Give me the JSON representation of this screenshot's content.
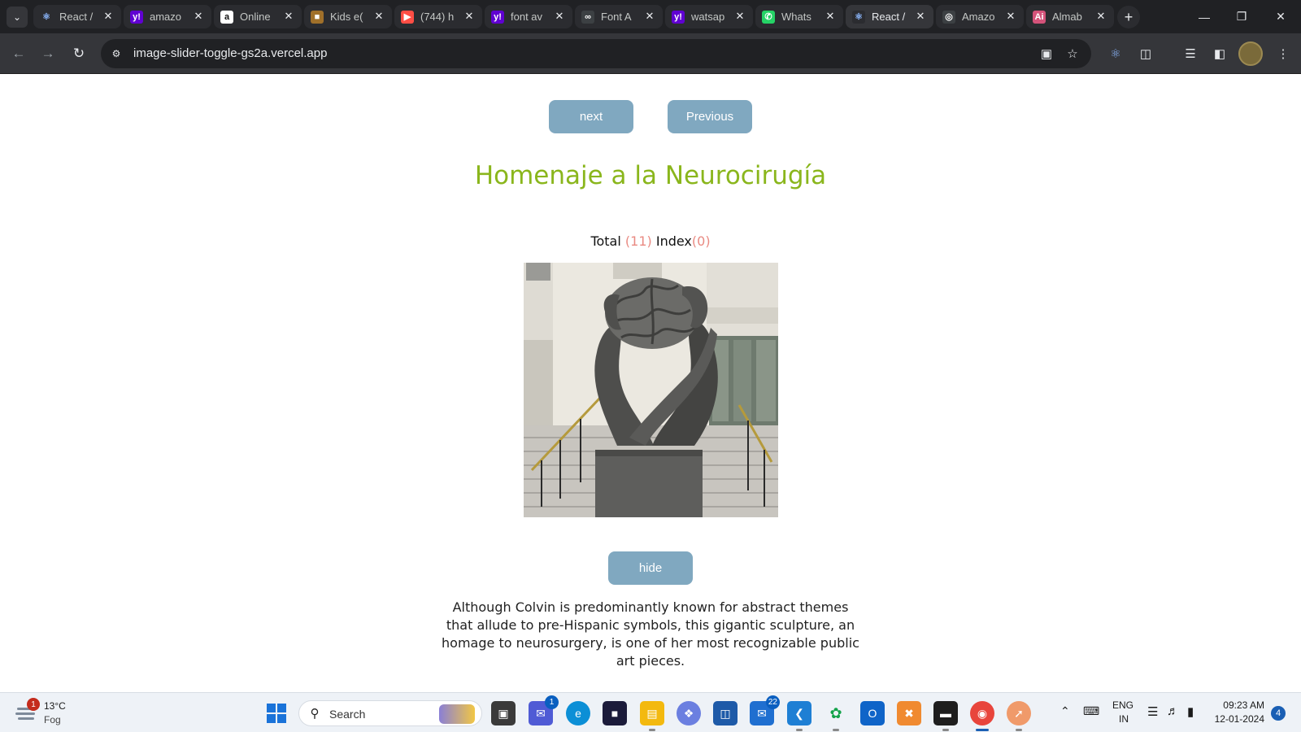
{
  "browser": {
    "tabs": [
      {
        "title": "React /",
        "icon": "react-icon",
        "color": "#2b2c30"
      },
      {
        "title": "amazo",
        "icon": "yahoo-icon",
        "color": "#6001d2"
      },
      {
        "title": "Online",
        "icon": "amazon-icon",
        "color": "#ffffff"
      },
      {
        "title": "Kids e(",
        "icon": "book-icon",
        "color": "#a0702a"
      },
      {
        "title": "(744) h",
        "icon": "youtube-icon",
        "color": "#ff4e45"
      },
      {
        "title": "font av",
        "icon": "yahoo-icon",
        "color": "#6001d2"
      },
      {
        "title": "Font A",
        "icon": "link-icon",
        "color": "#3c4043"
      },
      {
        "title": "watsap",
        "icon": "yahoo-icon",
        "color": "#6001d2"
      },
      {
        "title": "Whats",
        "icon": "whatsapp-icon",
        "color": "#25d366"
      },
      {
        "title": "React /",
        "icon": "react-icon",
        "color": "#2b2c30",
        "active": true
      },
      {
        "title": "Amazo",
        "icon": "globe-icon",
        "color": "#3c4043"
      },
      {
        "title": "Almab",
        "icon": "ai-icon",
        "color": "#d4537a"
      }
    ],
    "url": "image-slider-toggle-gs2a.vercel.app"
  },
  "slider": {
    "next_label": "next",
    "previous_label": "Previous",
    "title": "Homenaje a la Neurocirugía",
    "total_label": "Total",
    "total_value": "(11)",
    "index_label": "Index",
    "index_value": "(0)",
    "image_alt": "Homenaje a la Neurocirugía sculpture",
    "toggle_label": "hide",
    "description": "Although Colvin is predominantly known for abstract themes that allude to pre-Hispanic symbols, this gigantic sculpture, an homage to neurosurgery, is one of her most recognizable public art pieces."
  },
  "taskbar": {
    "weather_temp": "13°C",
    "weather_desc": "Fog",
    "weather_badge": "1",
    "search_label": "Search",
    "chat_badge": "1",
    "mail_badge": "22",
    "lang_top": "ENG",
    "lang_bottom": "IN",
    "time": "09:23 AM",
    "date": "12-01-2024",
    "notifications": "4"
  }
}
